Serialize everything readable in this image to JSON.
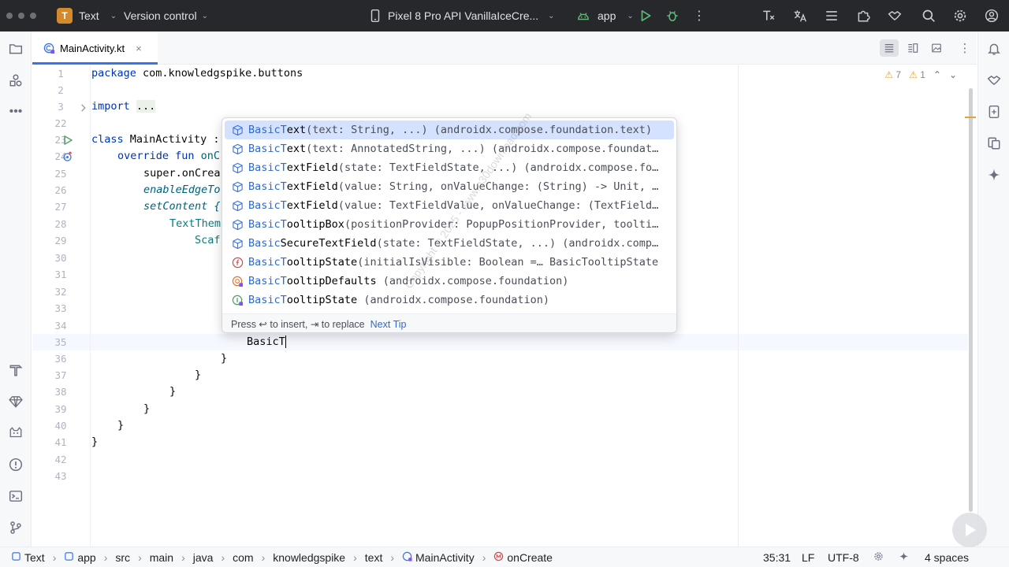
{
  "titlebar": {
    "project_badge": "T",
    "project_name": "Text",
    "version_control": "Version control",
    "device": "Pixel 8 Pro API VanillaIceCre...",
    "run_config": "app"
  },
  "tab": {
    "label": "MainActivity.kt",
    "close": "×"
  },
  "inspections": {
    "warnings": "7",
    "weak_warnings": "1"
  },
  "gutter": [
    "1",
    "2",
    "3",
    "22",
    "23",
    "24",
    "25",
    "26",
    "27",
    "28",
    "29",
    "30",
    "31",
    "32",
    "33",
    "34",
    "35",
    "36",
    "37",
    "38",
    "39",
    "40",
    "41",
    "42",
    "43"
  ],
  "code": {
    "l1_kw": "package",
    "l1_rest": " com.knowledgspike.buttons",
    "l3_kw": "import",
    "l3_fold": "...",
    "l23_kw": "class",
    "l23_rest": " MainActivity :",
    "l24_kw": "override fun",
    "l24_fn": " onC",
    "l25": "super.onCrea",
    "l26": "enableEdgeTo",
    "l27": "setContent {",
    "l28": "TextThem",
    "l29": "Scaf",
    "l35": "BasicT",
    "l36": "}",
    "l37": "}",
    "l38": "}",
    "l39": "}",
    "l40": "}",
    "l41": "}"
  },
  "completion": {
    "items": [
      {
        "match": "BasicT",
        "rest": "ext",
        "tail": "(text: String, ...) (androidx.compose.foundation.text)",
        "icon": "cube-icon"
      },
      {
        "match": "BasicT",
        "rest": "ext",
        "tail": "(text: AnnotatedString, ...) (androidx.compose.foundat…",
        "icon": "cube-icon"
      },
      {
        "match": "BasicT",
        "rest": "extField",
        "tail": "(state: TextFieldState, ...) (androidx.compose.fo…",
        "icon": "cube-icon"
      },
      {
        "match": "BasicT",
        "rest": "extField",
        "tail": "(value: String, onValueChange: (String) -> Unit, …",
        "icon": "cube-icon"
      },
      {
        "match": "BasicT",
        "rest": "extField",
        "tail": "(value: TextFieldValue, onValueChange: (TextField…",
        "icon": "cube-icon"
      },
      {
        "match": "BasicT",
        "rest": "ooltipBox",
        "tail": "(positionProvider: PopupPositionProvider, toolti…",
        "icon": "cube-icon"
      },
      {
        "match": "Basic",
        "rest": "SecureTextField",
        "tail": "(state: TextFieldState, ...) (androidx.comp…",
        "icon": "cube-icon"
      },
      {
        "match": "BasicT",
        "rest": "ooltipState",
        "tail": "(initialIsVisible: Boolean =… BasicTooltipState",
        "icon": "function-icon"
      },
      {
        "match": "BasicT",
        "rest": "ooltipDefaults",
        "tail": " (androidx.compose.foundation)",
        "icon": "object-icon"
      },
      {
        "match": "BasicT",
        "rest": "ooltipState",
        "tail": " (androidx.compose.foundation)",
        "icon": "interface-icon"
      }
    ],
    "footer_text": "Press ↩ to insert, ⇥ to replace",
    "footer_link": "Next Tip"
  },
  "watermark": "Copyright © 2025 - www.p30download.com",
  "statusbar": {
    "crumbs": [
      "Text",
      "app",
      "src",
      "main",
      "java",
      "com",
      "knowledgspike",
      "text",
      "MainActivity",
      "onCreate"
    ],
    "position": "35:31",
    "line_sep": "LF",
    "encoding": "UTF-8",
    "indent": "4 spaces"
  }
}
